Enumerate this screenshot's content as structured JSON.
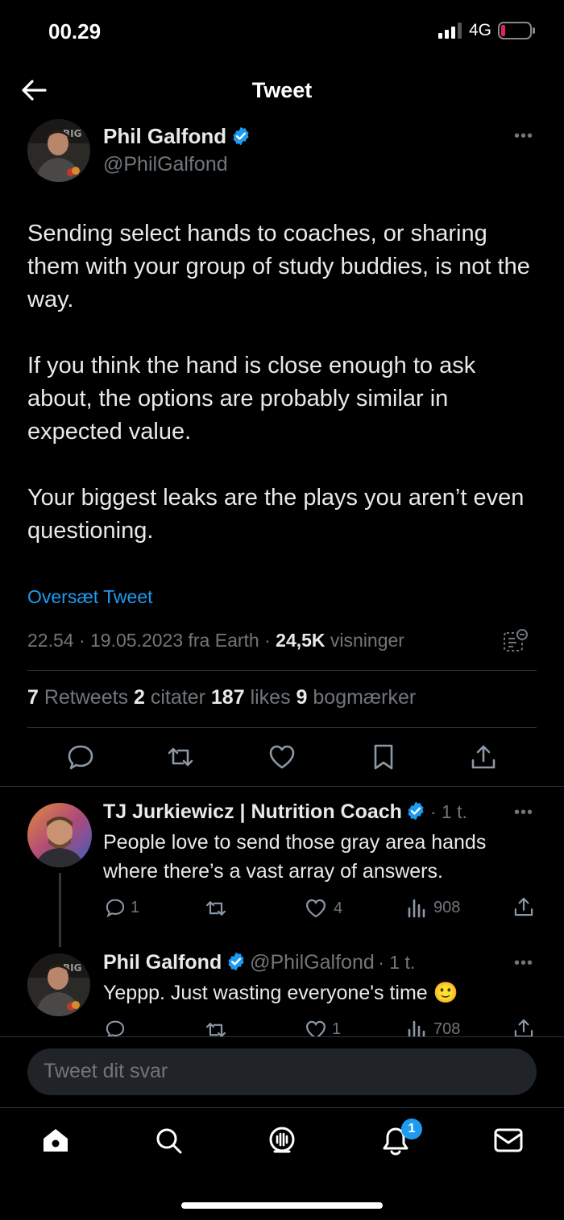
{
  "status_bar": {
    "time": "00.29",
    "network": "4G"
  },
  "header": {
    "title": "Tweet"
  },
  "tweet": {
    "author_name": "Phil Galfond",
    "author_handle": "@PhilGalfond",
    "paragraphs": [
      "Sending select hands to coaches, or sharing them with your group of study buddies, is not the way.",
      "If you think the hand is close enough to ask about, the options are probably similar in expected value.",
      "Your biggest leaks are the plays you aren’t even questioning."
    ],
    "translate_label": "Oversæt Tweet",
    "meta_prefix": "22.54 · 19.05.2023 fra Earth · ",
    "views_count": "24,5K",
    "views_label": " visninger",
    "stats": {
      "retweets_count": "7",
      "retweets_label": " Retweets  ",
      "quotes_count": "2",
      "quotes_label": " citater  ",
      "likes_count": "187",
      "likes_label": " likes  ",
      "bookmarks_count": "9",
      "bookmarks_label": " bogmærker"
    }
  },
  "replies": [
    {
      "author_name": "TJ Jurkiewicz | Nutrition Coach",
      "meta": "· 1 t.",
      "text_line1": "People love to send those gray area hands",
      "text_line2": "where there’s a vast array of answers.",
      "reply_count": "1",
      "like_count": "4",
      "views": "908"
    },
    {
      "author_name": "Phil Galfond",
      "author_handle": "@PhilGalfond",
      "meta": "· 1 t.",
      "text": "Yeppp. Just wasting everyone's time 🙂",
      "like_count": "1",
      "views": "708"
    }
  ],
  "compose": {
    "placeholder": "Tweet dit svar"
  },
  "tabbar": {
    "notification_badge": "1"
  },
  "colors": {
    "accent": "#1d9bf0",
    "background": "#000000",
    "text": "#e7e9ea",
    "muted": "#71767b",
    "battery_low": "#e0245e"
  }
}
